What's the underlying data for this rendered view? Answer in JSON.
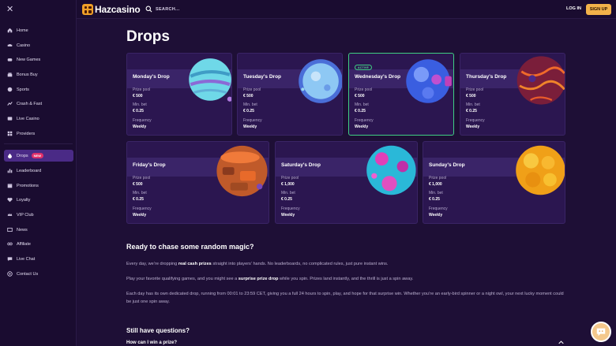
{
  "sidebar": {
    "close": "✕",
    "items": [
      {
        "label": "Home",
        "icon": "home-icon"
      },
      {
        "label": "Casino",
        "icon": "casino-icon"
      },
      {
        "label": "New Games",
        "icon": "new-games-icon"
      },
      {
        "label": "Bonus Buy",
        "icon": "bonus-buy-icon"
      },
      {
        "label": "Sports",
        "icon": "sports-icon"
      },
      {
        "label": "Crash & Fast",
        "icon": "crash-icon"
      },
      {
        "label": "Live Casino",
        "icon": "live-casino-icon"
      },
      {
        "label": "Providers",
        "icon": "providers-icon"
      },
      {
        "label": "Drops",
        "icon": "drops-icon",
        "badge": "NEW"
      },
      {
        "label": "Leaderboard",
        "icon": "leaderboard-icon"
      },
      {
        "label": "Promotions",
        "icon": "promotions-icon"
      },
      {
        "label": "Loyalty",
        "icon": "loyalty-icon"
      },
      {
        "label": "VIP Club",
        "icon": "vip-icon"
      },
      {
        "label": "News",
        "icon": "news-icon"
      },
      {
        "label": "Affiliate",
        "icon": "affiliate-icon"
      },
      {
        "label": "Live Chat",
        "icon": "live-chat-icon"
      },
      {
        "label": "Contact Us",
        "icon": "contact-icon"
      }
    ]
  },
  "topbar": {
    "logo": "Hazcasino",
    "search": "SEARCH...",
    "login": "LOG IN",
    "signup": "SIGN UP"
  },
  "page": {
    "title": "Drops"
  },
  "labels": {
    "pool": "Prize pool",
    "bet": "Min. bet",
    "freq": "Frequency",
    "active": "ACTIVE"
  },
  "drops": [
    {
      "name": "Monday's Drop",
      "pool": "€ 500",
      "bet": "€ 0.25",
      "freq": "Weekly",
      "active": false
    },
    {
      "name": "Tuesday's Drop",
      "pool": "€ 500",
      "bet": "€ 0.25",
      "freq": "Weekly",
      "active": false
    },
    {
      "name": "Wednesday's Drop",
      "pool": "€ 500",
      "bet": "€ 0.25",
      "freq": "Weekly",
      "active": true
    },
    {
      "name": "Thursday's Drop",
      "pool": "€ 500",
      "bet": "€ 0.25",
      "freq": "Weekly",
      "active": false
    },
    {
      "name": "Friday's Drop",
      "pool": "€ 500",
      "bet": "€ 0.25",
      "freq": "Weekly",
      "active": false
    },
    {
      "name": "Saturday's Drop",
      "pool": "€ 1,000",
      "bet": "€ 0.25",
      "freq": "Weekly",
      "active": false
    },
    {
      "name": "Sunday's Drop",
      "pool": "€ 1,000",
      "bet": "€ 0.25",
      "freq": "Weekly",
      "active": false
    }
  ],
  "info": {
    "heading": "Ready to chase some random magic?",
    "p1_a": "Every day, we’re dropping ",
    "p1_b": "real cash prizes",
    "p1_c": " straight into players’ hands. No leaderboards, no complicated rules, just pure instant wins.",
    "p2_a": "Play your favorite qualifying games, and you might see a ",
    "p2_b": "surprise prize drop",
    "p2_c": " while you spin. Prizes land instantly, and the thrill is just a spin away.",
    "p3": "Each day has its own dedicated drop, running from 00:01 to 23:59 CET, giving you a full 24 hours to spin, play, and hope for that surprise win. Whether you’re an early-bird spinner or a night owl, your next lucky moment could be just one spin away."
  },
  "faq": {
    "heading": "Still have questions?",
    "q1": "How can I win a prize?"
  },
  "colors": {
    "bg": "#1e0f36",
    "card": "#2b1650",
    "active_border": "#3fcf83",
    "accent": "#f2b24a"
  }
}
